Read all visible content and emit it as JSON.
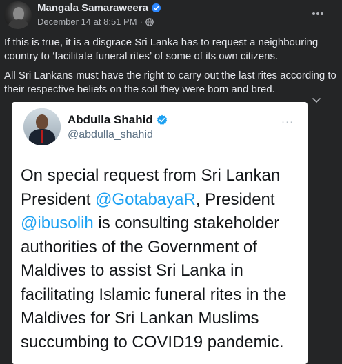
{
  "post": {
    "author_name": "Mangala Samaraweera",
    "timestamp": "December 14 at 8:51 PM",
    "separator": "·",
    "paragraph_1": "If this is true, it is a disgrace Sri Lanka has to request a neighbouring country to ‘facilitate funeral rites’ of some of its own citizens.",
    "paragraph_2": "All Sri Lankans must have the right to carry out the last rites according to their respective beliefs on the soil they were born and bred.",
    "more_label": "···"
  },
  "embedded_tweet": {
    "name": "Abdulla Shahid",
    "handle": "@abdulla_shahid",
    "more_label": "···",
    "text_before_mention_1": "On special request from Sri Lankan President ",
    "mention_1": "@GotabayaR",
    "text_between_mentions": ", President ",
    "mention_2": "@ibusolih",
    "text_after_mention_2": " is consulting stakeholder authorities of the Government of Maldives to assist Sri Lanka in facilitating Islamic funeral rites in the Maldives for Sri Lankan Muslims succumbing to COVID19 pandemic."
  },
  "icons": {
    "author_verified": "verified-badge-icon",
    "privacy": "globe-icon",
    "more": "more-options-icon",
    "tweet_verified": "verified-badge-icon",
    "collapse": "chevron-down-icon"
  },
  "colors": {
    "background": "#242526",
    "primary_text": "#e4e6eb",
    "secondary_text": "#b0b3b8",
    "verified_fb": "#2d88ff",
    "verified_tw": "#1da1f2",
    "mention": "#1da1f2"
  }
}
